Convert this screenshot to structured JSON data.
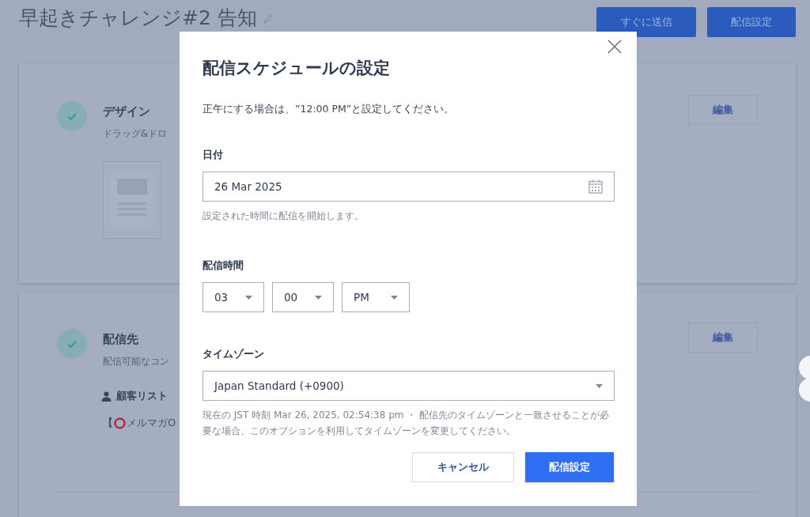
{
  "page": {
    "title": "早起きチャレンジ#2 告知",
    "buttons": [
      "すぐに送信",
      "配信設定"
    ]
  },
  "sections": [
    {
      "title": "デザイン",
      "description": "ドラッグ&ドロ",
      "done": true,
      "edit": "編集",
      "kind": "design"
    },
    {
      "title": "配信先",
      "description": "配信可能なコン",
      "done": true,
      "edit": "編集",
      "kind": "recipients",
      "list_label": "顧客リスト",
      "list_bracket": "【",
      "list_name": "メルマガO"
    }
  ],
  "dialog": {
    "title": "配信スケジュールの設定",
    "note": "正午にする場合は、”12:00 PM”と設定してください。",
    "date_label": "日付",
    "date_value": "26 Mar 2025",
    "date_help": "設定された時間に配信を開始します。",
    "time_label": "配信時間",
    "time_selects": [
      "03",
      "00",
      "PM"
    ],
    "timezone_label": "タイムゾーン",
    "timezone_value": "Japan Standard (+0900)",
    "timezone_help": "現在の JST 時刻 Mar 26, 2025, 02:54:38 pm ・ 配信先のタイムゾーンと一致させることが必要な場合、このオプションを利用してタイムゾーンを変更してください。",
    "cancel": "キャンセル",
    "confirm": "配信設定"
  }
}
